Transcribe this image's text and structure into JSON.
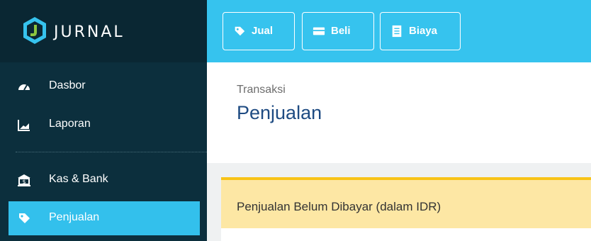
{
  "brand": {
    "name": "JURNAL"
  },
  "sidebar": {
    "items": [
      {
        "label": "Dasbor",
        "icon": "dashboard-gauge-icon"
      },
      {
        "label": "Laporan",
        "icon": "report-chart-icon"
      },
      {
        "label": "Kas & Bank",
        "icon": "bank-icon"
      },
      {
        "label": "Penjualan",
        "icon": "tag-icon",
        "active": true
      }
    ]
  },
  "toolbar": {
    "buttons": [
      {
        "label": "Jual",
        "icon": "tag-icon"
      },
      {
        "label": "Beli",
        "icon": "card-icon"
      },
      {
        "label": "Biaya",
        "icon": "receipt-icon"
      }
    ]
  },
  "header": {
    "breadcrumb": "Transaksi",
    "title": "Penjualan"
  },
  "card": {
    "title": "Penjualan Belum Dibayar (dalam IDR)"
  },
  "colors": {
    "sidebar": "#0c2f3d",
    "accent": "#36c3ee",
    "title": "#1e4b82",
    "card_header": "#fde7a4",
    "card_border": "#f8c317"
  }
}
